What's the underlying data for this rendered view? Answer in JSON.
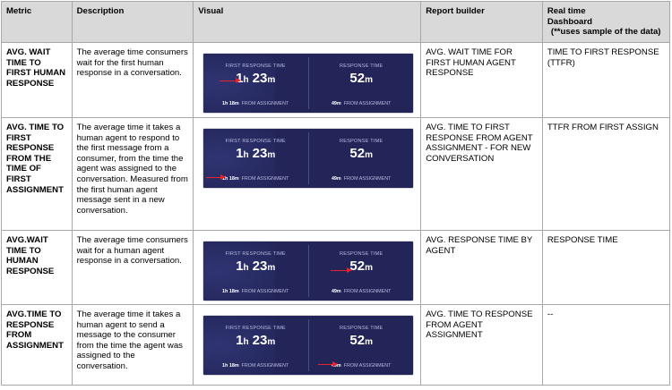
{
  "headers": {
    "metric": "Metric",
    "description": "Description",
    "visual": "Visual",
    "report_builder": "Report builder",
    "realtime_line1": "Real time",
    "realtime_line2": "Dashboard",
    "realtime_line3": "(**uses sample of the data)"
  },
  "panel": {
    "first_response_label": "FIRST RESPONSE TIME",
    "response_label": "RESPONSE TIME",
    "first_hours": "1",
    "hours_unit": "h",
    "first_minutes": "23",
    "minutes_unit": "m",
    "first_sub_value": "1h 18m",
    "response_minutes": "52",
    "response_sub_value": "49m",
    "sub_label": "FROM ASSIGNMENT",
    "arrow_color": "#e8232a",
    "panel_color": "#232559"
  },
  "rows": [
    {
      "metric": "AVG. WAIT TIME TO FIRST HUMAN RESPONSE",
      "description": "The average time consumers wait for the first human response in a conversation.",
      "arrow_target": "first-response-big-value",
      "report_builder": "AVG. WAIT TIME FOR FIRST HUMAN AGENT RESPONSE",
      "realtime": "TIME TO FIRST RESPONSE (TTFR)"
    },
    {
      "metric": "AVG. TIME TO FIRST RESPONSE FROM THE TIME OF FIRST ASSIGNMENT",
      "description": "The average time it takes a human agent to respond to the first message from a consumer, from the time the agent was assigned to the conversation. Measured from the first human agent message sent in a new conversation.",
      "arrow_target": "first-response-from-assignment",
      "report_builder": "AVG. TIME TO FIRST RESPONSE FROM AGENT ASSIGNMENT - FOR NEW CONVERSATION",
      "realtime": "TTFR FROM FIRST ASSIGN"
    },
    {
      "metric": "AVG.WAIT TIME TO HUMAN RESPONSE",
      "description": "The average time consumers wait for a human agent response in a conversation.",
      "arrow_target": "response-big-value",
      "report_builder": "AVG. RESPONSE TIME BY AGENT",
      "realtime": "RESPONSE TIME"
    },
    {
      "metric": "AVG.TIME TO RESPONSE FROM ASSIGNMENT",
      "description": "The average time it takes a human agent to send a message to the consumer from the time the agent was assigned to the conversation.",
      "arrow_target": "response-from-assignment",
      "report_builder": "AVG. TIME TO RESPONSE FROM AGENT ASSIGNMENT",
      "realtime": "--"
    }
  ]
}
